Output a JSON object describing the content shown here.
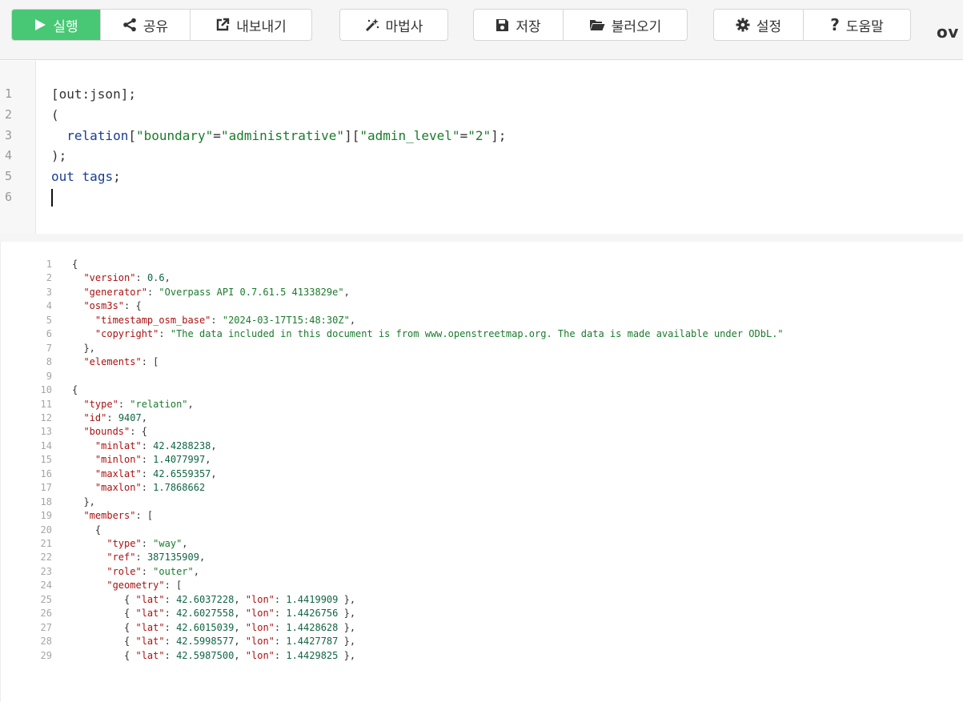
{
  "toolbar": {
    "groups": [
      [
        {
          "name": "run-button",
          "icon": "play-icon",
          "label": "실행",
          "style": "run"
        },
        {
          "name": "share-button",
          "icon": "share-icon",
          "label": "공유"
        },
        {
          "name": "export-button",
          "icon": "external-link-icon",
          "label": "내보내기"
        }
      ],
      [
        {
          "name": "wizard-button",
          "icon": "magic-wand-icon",
          "label": "마법사"
        }
      ],
      [
        {
          "name": "save-button",
          "icon": "floppy-disk-icon",
          "label": "저장"
        },
        {
          "name": "load-button",
          "icon": "folder-open-icon",
          "label": "불러오기"
        }
      ],
      [
        {
          "name": "settings-button",
          "icon": "gear-icon",
          "label": "설정"
        },
        {
          "name": "help-button",
          "icon": "question-icon",
          "label": "도움말"
        }
      ]
    ],
    "brand": "ov",
    "accent": "#48c774"
  },
  "query": {
    "lines": [
      [
        [
          "p",
          "[out:json];"
        ]
      ],
      [
        [
          "p",
          "("
        ]
      ],
      [
        [
          "p",
          "  "
        ],
        [
          "w",
          "relation"
        ],
        [
          "p",
          "["
        ],
        [
          "s",
          "\"boundary\""
        ],
        [
          "p",
          "="
        ],
        [
          "s",
          "\"administrative\""
        ],
        [
          "p",
          "]["
        ],
        [
          "s",
          "\"admin_level\""
        ],
        [
          "p",
          "="
        ],
        [
          "s",
          "\"2\""
        ],
        [
          "p",
          "];"
        ]
      ],
      [
        [
          "p",
          ");"
        ]
      ],
      [
        [
          "w",
          "out"
        ],
        [
          "p",
          " "
        ],
        [
          "w",
          "tags"
        ],
        [
          "p",
          ";"
        ]
      ],
      [
        [
          "p",
          ""
        ]
      ]
    ]
  },
  "result": {
    "lines": [
      [
        [
          "p",
          "{"
        ]
      ],
      [
        [
          "p",
          "  "
        ],
        [
          "k",
          "\"version\""
        ],
        [
          "p",
          ": "
        ],
        [
          "n",
          "0.6"
        ],
        [
          "p",
          ","
        ]
      ],
      [
        [
          "p",
          "  "
        ],
        [
          "k",
          "\"generator\""
        ],
        [
          "p",
          ": "
        ],
        [
          "s",
          "\"Overpass API 0.7.61.5 4133829e\""
        ],
        [
          "p",
          ","
        ]
      ],
      [
        [
          "p",
          "  "
        ],
        [
          "k",
          "\"osm3s\""
        ],
        [
          "p",
          ": {"
        ]
      ],
      [
        [
          "p",
          "    "
        ],
        [
          "k",
          "\"timestamp_osm_base\""
        ],
        [
          "p",
          ": "
        ],
        [
          "s",
          "\"2024-03-17T15:48:30Z\""
        ],
        [
          "p",
          ","
        ]
      ],
      [
        [
          "p",
          "    "
        ],
        [
          "k",
          "\"copyright\""
        ],
        [
          "p",
          ": "
        ],
        [
          "s",
          "\"The data included in this document is from www.openstreetmap.org. The data is made available under ODbL.\""
        ]
      ],
      [
        [
          "p",
          "  },"
        ]
      ],
      [
        [
          "p",
          "  "
        ],
        [
          "k",
          "\"elements\""
        ],
        [
          "p",
          ": ["
        ]
      ],
      [
        [
          "p",
          ""
        ]
      ],
      [
        [
          "p",
          "{"
        ]
      ],
      [
        [
          "p",
          "  "
        ],
        [
          "k",
          "\"type\""
        ],
        [
          "p",
          ": "
        ],
        [
          "s",
          "\"relation\""
        ],
        [
          "p",
          ","
        ]
      ],
      [
        [
          "p",
          "  "
        ],
        [
          "k",
          "\"id\""
        ],
        [
          "p",
          ": "
        ],
        [
          "n",
          "9407"
        ],
        [
          "p",
          ","
        ]
      ],
      [
        [
          "p",
          "  "
        ],
        [
          "k",
          "\"bounds\""
        ],
        [
          "p",
          ": {"
        ]
      ],
      [
        [
          "p",
          "    "
        ],
        [
          "k",
          "\"minlat\""
        ],
        [
          "p",
          ": "
        ],
        [
          "n",
          "42.4288238"
        ],
        [
          "p",
          ","
        ]
      ],
      [
        [
          "p",
          "    "
        ],
        [
          "k",
          "\"minlon\""
        ],
        [
          "p",
          ": "
        ],
        [
          "n",
          "1.4077997"
        ],
        [
          "p",
          ","
        ]
      ],
      [
        [
          "p",
          "    "
        ],
        [
          "k",
          "\"maxlat\""
        ],
        [
          "p",
          ": "
        ],
        [
          "n",
          "42.6559357"
        ],
        [
          "p",
          ","
        ]
      ],
      [
        [
          "p",
          "    "
        ],
        [
          "k",
          "\"maxlon\""
        ],
        [
          "p",
          ": "
        ],
        [
          "n",
          "1.7868662"
        ]
      ],
      [
        [
          "p",
          "  },"
        ]
      ],
      [
        [
          "p",
          "  "
        ],
        [
          "k",
          "\"members\""
        ],
        [
          "p",
          ": ["
        ]
      ],
      [
        [
          "p",
          "    {"
        ]
      ],
      [
        [
          "p",
          "      "
        ],
        [
          "k",
          "\"type\""
        ],
        [
          "p",
          ": "
        ],
        [
          "s",
          "\"way\""
        ],
        [
          "p",
          ","
        ]
      ],
      [
        [
          "p",
          "      "
        ],
        [
          "k",
          "\"ref\""
        ],
        [
          "p",
          ": "
        ],
        [
          "n",
          "387135909"
        ],
        [
          "p",
          ","
        ]
      ],
      [
        [
          "p",
          "      "
        ],
        [
          "k",
          "\"role\""
        ],
        [
          "p",
          ": "
        ],
        [
          "s",
          "\"outer\""
        ],
        [
          "p",
          ","
        ]
      ],
      [
        [
          "p",
          "      "
        ],
        [
          "k",
          "\"geometry\""
        ],
        [
          "p",
          ": ["
        ]
      ],
      [
        [
          "p",
          "         { "
        ],
        [
          "k",
          "\"lat\""
        ],
        [
          "p",
          ": "
        ],
        [
          "n",
          "42.6037228"
        ],
        [
          "p",
          ", "
        ],
        [
          "k",
          "\"lon\""
        ],
        [
          "p",
          ": "
        ],
        [
          "n",
          "1.4419909"
        ],
        [
          "p",
          " },"
        ]
      ],
      [
        [
          "p",
          "         { "
        ],
        [
          "k",
          "\"lat\""
        ],
        [
          "p",
          ": "
        ],
        [
          "n",
          "42.6027558"
        ],
        [
          "p",
          ", "
        ],
        [
          "k",
          "\"lon\""
        ],
        [
          "p",
          ": "
        ],
        [
          "n",
          "1.4426756"
        ],
        [
          "p",
          " },"
        ]
      ],
      [
        [
          "p",
          "         { "
        ],
        [
          "k",
          "\"lat\""
        ],
        [
          "p",
          ": "
        ],
        [
          "n",
          "42.6015039"
        ],
        [
          "p",
          ", "
        ],
        [
          "k",
          "\"lon\""
        ],
        [
          "p",
          ": "
        ],
        [
          "n",
          "1.4428628"
        ],
        [
          "p",
          " },"
        ]
      ],
      [
        [
          "p",
          "         { "
        ],
        [
          "k",
          "\"lat\""
        ],
        [
          "p",
          ": "
        ],
        [
          "n",
          "42.5998577"
        ],
        [
          "p",
          ", "
        ],
        [
          "k",
          "\"lon\""
        ],
        [
          "p",
          ": "
        ],
        [
          "n",
          "1.4427787"
        ],
        [
          "p",
          " },"
        ]
      ],
      [
        [
          "p",
          "         { "
        ],
        [
          "k",
          "\"lat\""
        ],
        [
          "p",
          ": "
        ],
        [
          "n",
          "42.5987500"
        ],
        [
          "p",
          ", "
        ],
        [
          "k",
          "\"lon\""
        ],
        [
          "p",
          ": "
        ],
        [
          "n",
          "1.4429825"
        ],
        [
          "p",
          " },"
        ]
      ]
    ]
  }
}
